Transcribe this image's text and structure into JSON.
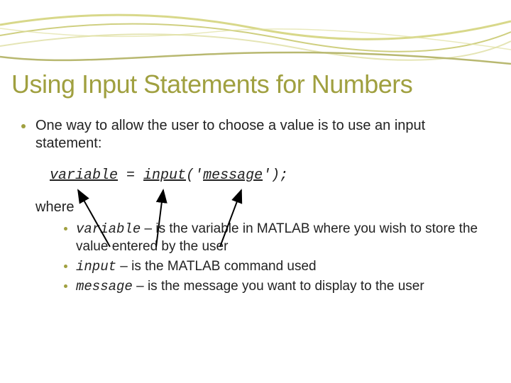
{
  "title": "Using Input Statements for Numbers",
  "intro": "One way to allow the user to choose a value is to use an input statement:",
  "code": {
    "var": "variable",
    "eq": " = ",
    "fn": "input",
    "open": "('",
    "msg": "message",
    "close": "');"
  },
  "where_label": "where",
  "items": [
    {
      "term": "variable",
      "sep": " – ",
      "desc": "is the variable in MATLAB where you wish to store the value entered by the user"
    },
    {
      "term": "input",
      "sep": " – ",
      "desc": "is the MATLAB command used"
    },
    {
      "term": "message",
      "sep": " – ",
      "desc": "is the message you want to display to the user"
    }
  ]
}
